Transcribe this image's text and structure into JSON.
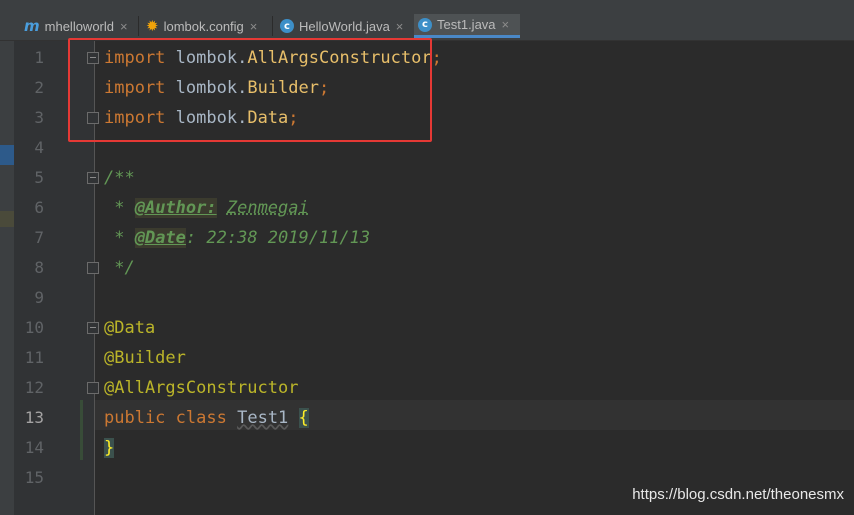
{
  "tabs": [
    {
      "label": "mhelloworld",
      "icon": "m-icon",
      "close": "×"
    },
    {
      "label": "lombok.config",
      "icon": "gear-icon",
      "close": "×"
    },
    {
      "label": "HelloWorld.java",
      "icon": "c-icon",
      "close": "×"
    },
    {
      "label": "Test1.java",
      "icon": "c-icon",
      "close": "×",
      "active": true
    }
  ],
  "icons": {
    "m": "m",
    "c": "c",
    "gear": "✹"
  },
  "line_numbers": [
    "1",
    "2",
    "3",
    "4",
    "5",
    "6",
    "7",
    "8",
    "9",
    "10",
    "11",
    "12",
    "13",
    "14",
    "15"
  ],
  "current_line": "13",
  "code": {
    "l1": {
      "kw": "import",
      "pkg": "lombok.",
      "cls": "AllArgsConstructor",
      "semi": ";"
    },
    "l2": {
      "kw": "import",
      "pkg": "lombok.",
      "cls": "Builder",
      "semi": ";"
    },
    "l3": {
      "kw": "import",
      "pkg": "lombok.",
      "cls": "Data",
      "semi": ";"
    },
    "l5": "/**",
    "l6": {
      "star": " * ",
      "tag": "@Author:",
      "sp": " ",
      "val": "Zenmegai"
    },
    "l7": {
      "star": " * ",
      "tag": "@Date",
      "rest": ": 22:38 2019/11/13"
    },
    "l8": " */",
    "l10": "@Data",
    "l11": "@Builder",
    "l12": "@AllArgsConstructor",
    "l13": {
      "kw1": "public",
      "kw2": "class",
      "name": "Test1",
      "brace": "{"
    },
    "l14": "}"
  },
  "watermark": "https://blog.csdn.net/theonesmx",
  "colors": {
    "highlight_box": "#e53935",
    "accent": "#4a88c7"
  }
}
